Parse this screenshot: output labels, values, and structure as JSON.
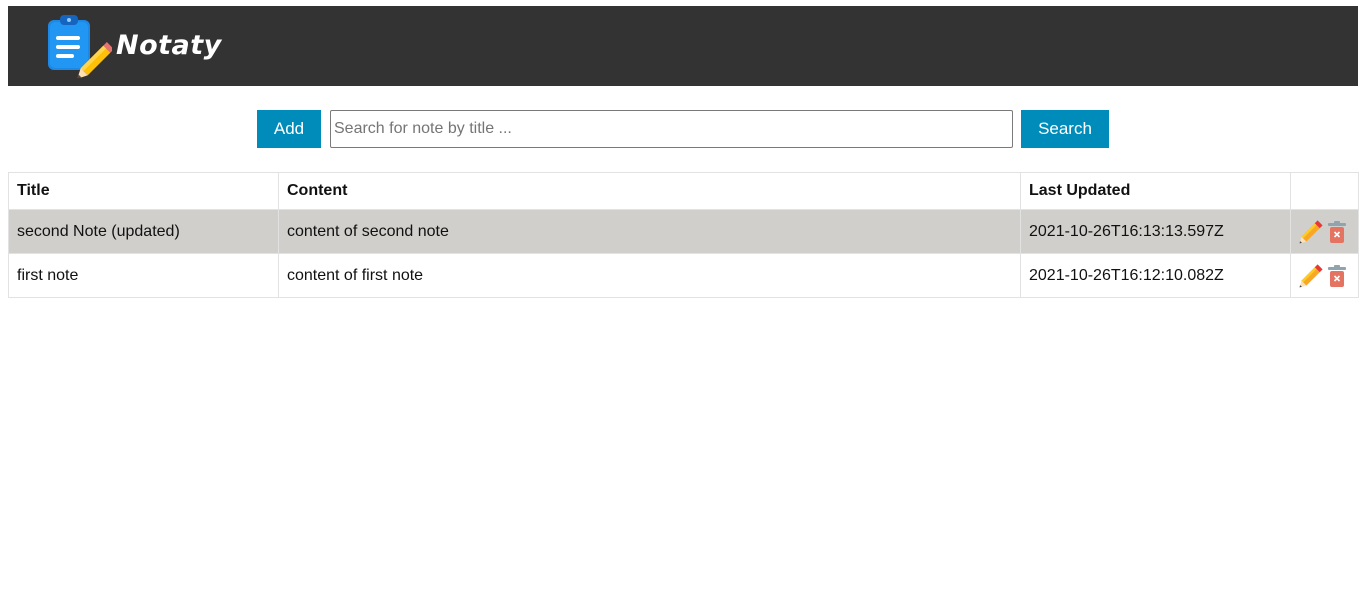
{
  "navbar": {
    "logo_text": "Notaty",
    "logo_icon": "clipboard-pencil-icon",
    "background": "#333333"
  },
  "toolbar": {
    "add_label": "Add",
    "search_placeholder": "Search for note by title ...",
    "search_value": "",
    "search_label": "Search",
    "accent": "#008cba"
  },
  "table": {
    "headers": [
      "Title",
      "Content",
      "Last Updated",
      ""
    ],
    "rows": [
      {
        "title": "second Note (updated)",
        "content": "content of second note",
        "updated": "2021-10-26T16:13:13.597Z",
        "selected": true
      },
      {
        "title": "first note",
        "content": "content of first note",
        "updated": "2021-10-26T16:12:10.082Z",
        "selected": false
      }
    ],
    "row_actions": [
      "pencil-edit-icon",
      "trash-delete-icon"
    ],
    "selected_row_color": "#d0cfcc"
  }
}
